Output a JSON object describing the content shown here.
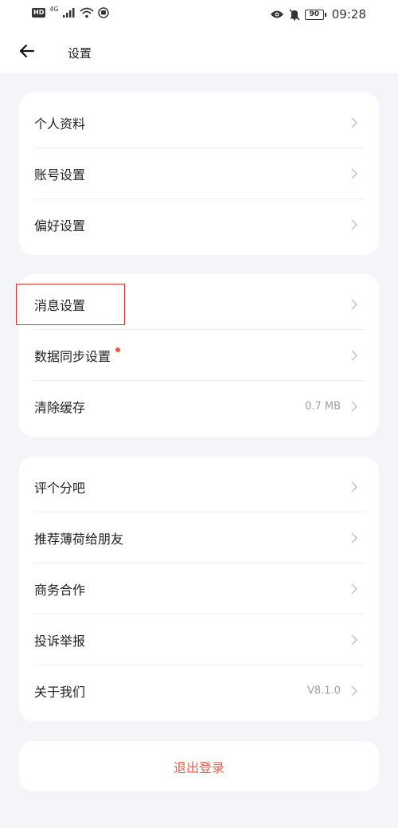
{
  "status_bar": {
    "net_type": "4G",
    "battery": "90",
    "time": "09:28"
  },
  "header": {
    "title": "设置"
  },
  "groups": [
    {
      "items": [
        {
          "label": "个人资料",
          "value": ""
        },
        {
          "label": "账号设置",
          "value": ""
        },
        {
          "label": "偏好设置",
          "value": ""
        }
      ]
    },
    {
      "items": [
        {
          "label": "消息设置",
          "value": ""
        },
        {
          "label": "数据同步设置",
          "value": ""
        },
        {
          "label": "清除缓存",
          "value": "0.7 MB"
        }
      ]
    },
    {
      "items": [
        {
          "label": "评个分吧",
          "value": ""
        },
        {
          "label": "推荐薄荷给朋友",
          "value": ""
        },
        {
          "label": "商务合作",
          "value": ""
        },
        {
          "label": "投诉举报",
          "value": ""
        },
        {
          "label": "关于我们",
          "value": "V8.1.0"
        }
      ]
    }
  ],
  "logout": {
    "label": "退出登录"
  },
  "colors": {
    "background": "#f4f5f9",
    "card": "#ffffff",
    "accent": "#e0624f",
    "highlight": "#d33a31",
    "notify_dot": "#e85a3a"
  }
}
